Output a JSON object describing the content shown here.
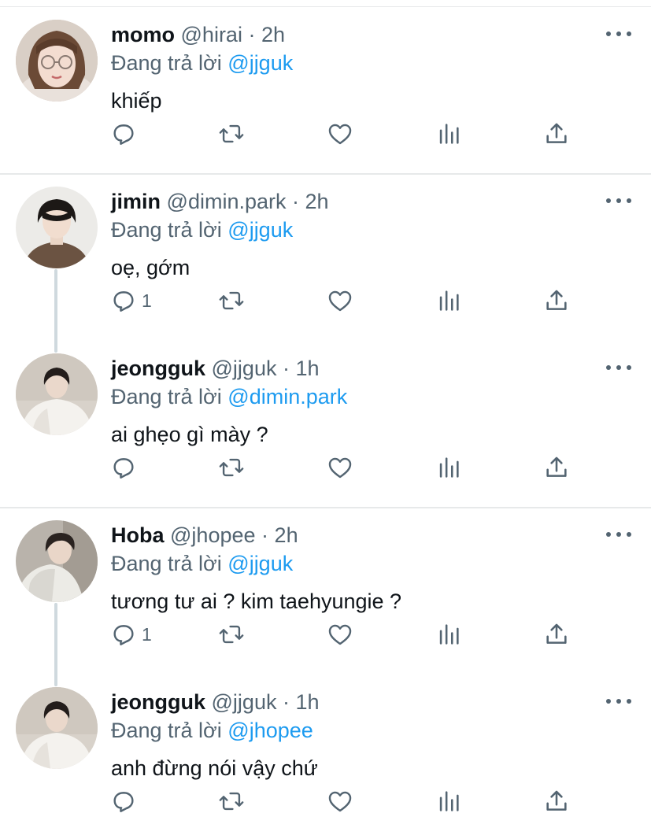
{
  "reply_prefix": "Đang trả lời",
  "tweets": [
    {
      "name": "momo",
      "handle": "@hirai",
      "sep": "·",
      "time": "2h",
      "reply_to": "@jjguk",
      "text": "khiếp",
      "reply_count": ""
    },
    {
      "name": "jimin",
      "handle": "@dimin.park",
      "sep": "·",
      "time": "2h",
      "reply_to": "@jjguk",
      "text": "oẹ, gớm",
      "reply_count": "1"
    },
    {
      "name": "jeongguk",
      "handle": "@jjguk",
      "sep": "·",
      "time": "1h",
      "reply_to": "@dimin.park",
      "text": "ai ghẹo gì mày ?",
      "reply_count": ""
    },
    {
      "name": "Hoba",
      "handle": "@jhopee",
      "sep": "·",
      "time": "2h",
      "reply_to": "@jjguk",
      "text": "tương tư ai ? kim taehyungie ?",
      "reply_count": "1"
    },
    {
      "name": "jeongguk",
      "handle": "@jjguk",
      "sep": "·",
      "time": "1h",
      "reply_to": "@jhopee",
      "text": "anh đừng nói vậy chứ",
      "reply_count": ""
    }
  ],
  "colors": {
    "accent": "#1d9bf0",
    "secondary_text": "#536471",
    "primary_text": "#0f1419",
    "divider": "#e7e9ea"
  },
  "icons": [
    "reply-icon",
    "retweet-icon",
    "like-icon",
    "views-icon",
    "share-icon",
    "more-icon"
  ]
}
